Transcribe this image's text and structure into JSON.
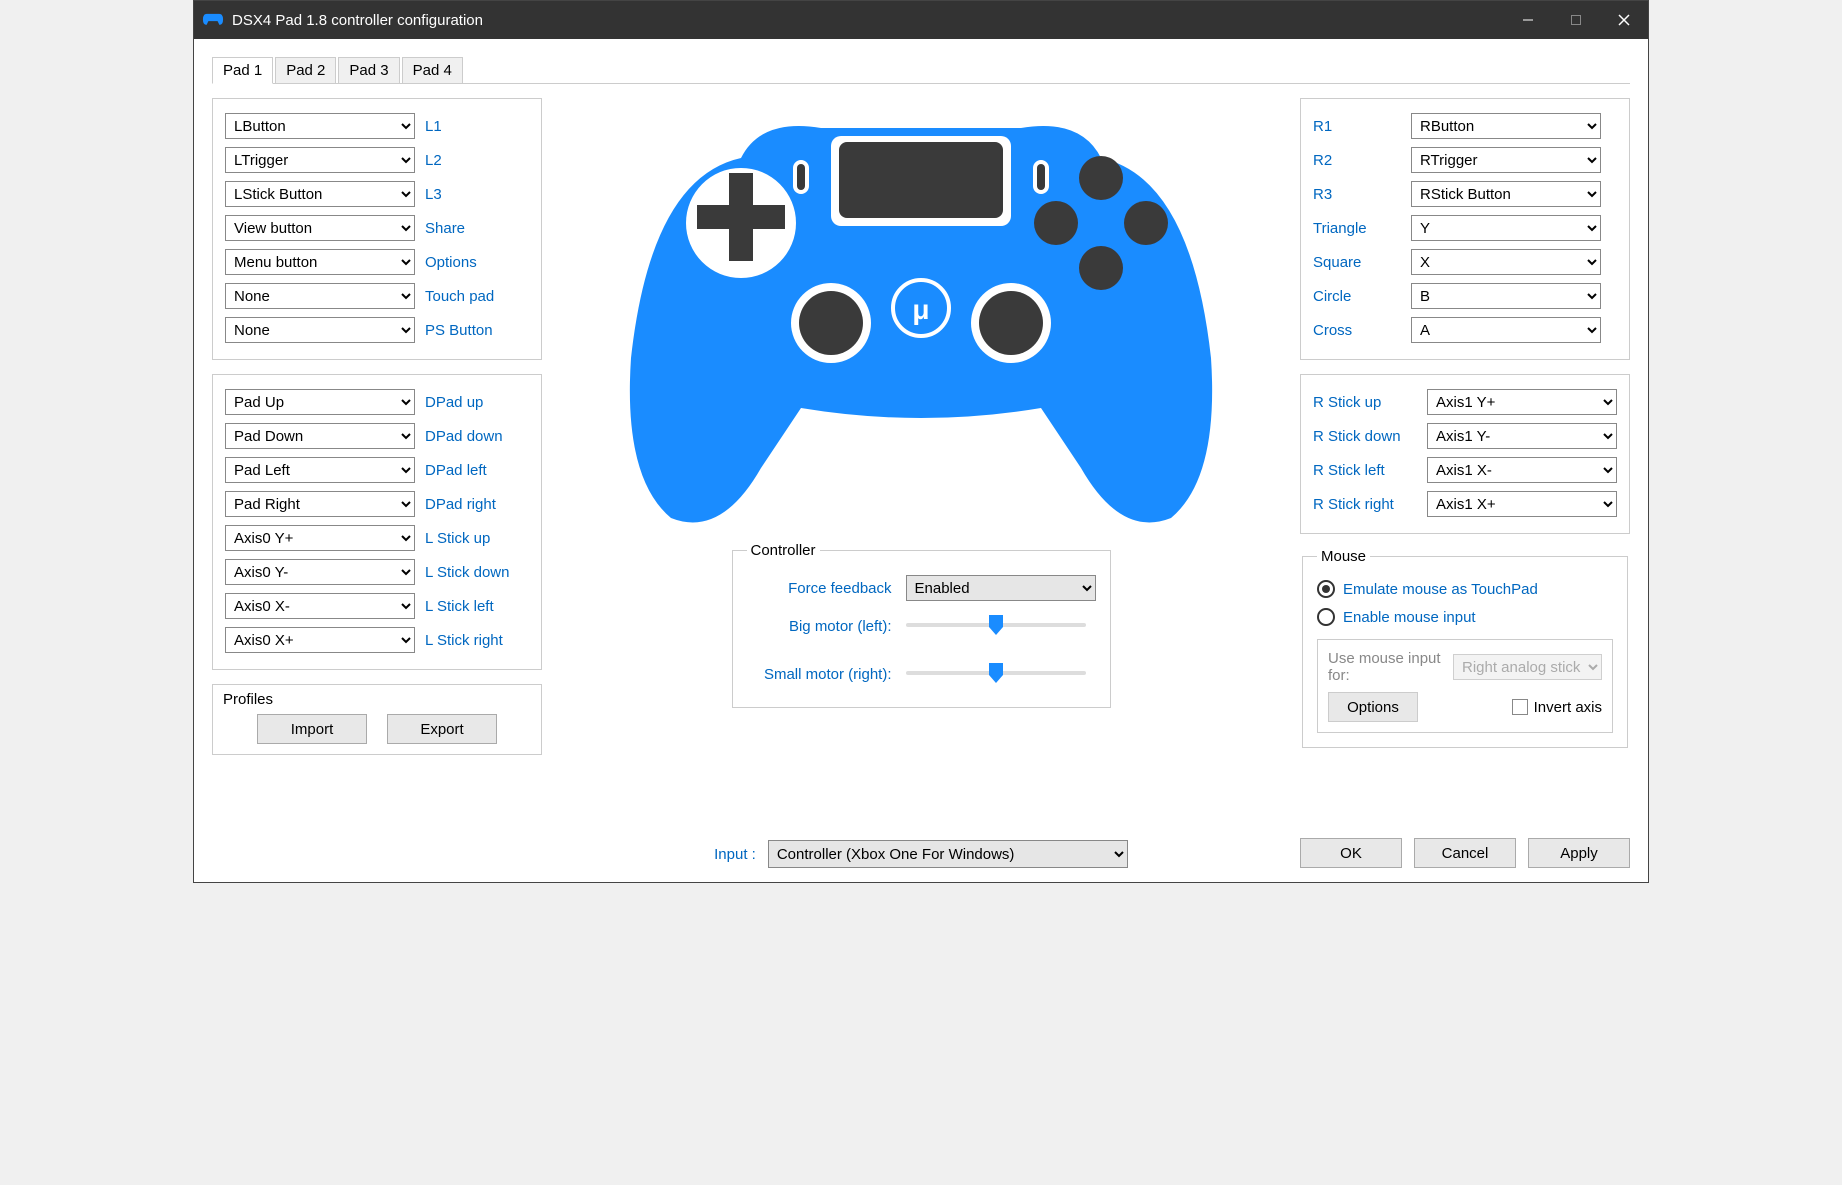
{
  "title": "DSX4 Pad 1.8 controller configuration",
  "tabs": [
    "Pad 1",
    "Pad 2",
    "Pad 3",
    "Pad 4"
  ],
  "active_tab": 0,
  "left_block1": [
    {
      "value": "LButton",
      "label": "L1"
    },
    {
      "value": "LTrigger",
      "label": "L2"
    },
    {
      "value": "LStick Button",
      "label": "L3"
    },
    {
      "value": "View button",
      "label": "Share"
    },
    {
      "value": "Menu button",
      "label": "Options"
    },
    {
      "value": "None",
      "label": "Touch pad"
    },
    {
      "value": "None",
      "label": "PS Button"
    }
  ],
  "left_block2": [
    {
      "value": "Pad Up",
      "label": "DPad up"
    },
    {
      "value": "Pad Down",
      "label": "DPad down"
    },
    {
      "value": "Pad Left",
      "label": "DPad left"
    },
    {
      "value": "Pad Right",
      "label": "DPad right"
    },
    {
      "value": "Axis0 Y+",
      "label": "L Stick up"
    },
    {
      "value": "Axis0 Y-",
      "label": "L Stick down"
    },
    {
      "value": "Axis0 X-",
      "label": "L Stick left"
    },
    {
      "value": "Axis0 X+",
      "label": "L Stick right"
    }
  ],
  "right_block1": [
    {
      "label": "R1",
      "value": "RButton"
    },
    {
      "label": "R2",
      "value": "RTrigger"
    },
    {
      "label": "R3",
      "value": "RStick Button"
    },
    {
      "label": "Triangle",
      "value": "Y"
    },
    {
      "label": "Square",
      "value": "X"
    },
    {
      "label": "Circle",
      "value": "B"
    },
    {
      "label": "Cross",
      "value": "A"
    }
  ],
  "right_block2": [
    {
      "label": "R Stick up",
      "value": "Axis1 Y+"
    },
    {
      "label": "R Stick down",
      "value": "Axis1 Y-"
    },
    {
      "label": "R Stick left",
      "value": "Axis1 X-"
    },
    {
      "label": "R Stick right",
      "value": "Axis1 X+"
    }
  ],
  "controller": {
    "legend": "Controller",
    "force_feedback_label": "Force feedback",
    "force_feedback_value": "Enabled",
    "big_motor_label": "Big motor (left):",
    "small_motor_label": "Small motor (right):"
  },
  "mouse": {
    "legend": "Mouse",
    "opt1": "Emulate mouse as TouchPad",
    "opt2": "Enable mouse input",
    "use_for_label": "Use mouse input for:",
    "use_for_value": "Right analog stick",
    "options_btn": "Options",
    "invert_label": "Invert axis"
  },
  "input_label": "Input :",
  "input_value": "Controller (Xbox One For Windows)",
  "profiles": {
    "title": "Profiles",
    "import": "Import",
    "export": "Export"
  },
  "buttons": {
    "ok": "OK",
    "cancel": "Cancel",
    "apply": "Apply"
  }
}
